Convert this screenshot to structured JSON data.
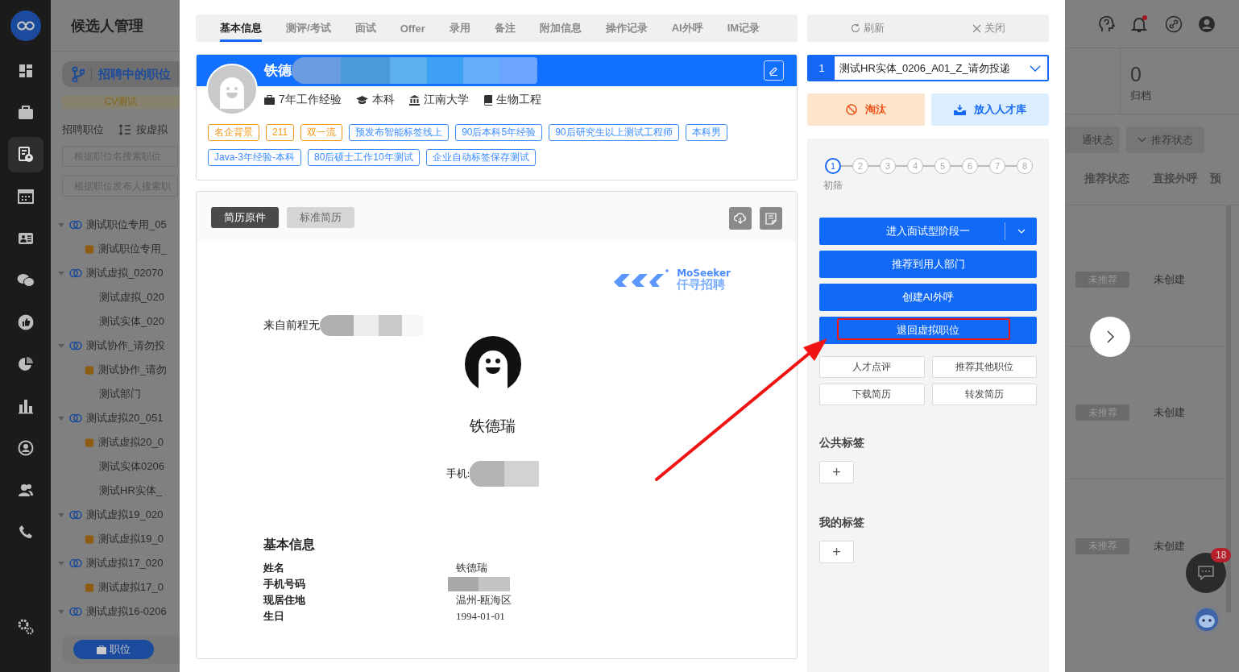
{
  "sidebar": {
    "items": [
      {
        "selected": false
      },
      {
        "selected": false
      },
      {
        "selected": true
      },
      {
        "selected": false
      },
      {
        "selected": false
      },
      {
        "selected": false
      },
      {
        "selected": false
      },
      {
        "selected": false
      },
      {
        "selected": false
      },
      {
        "selected": false
      },
      {
        "selected": false
      },
      {
        "selected": false
      }
    ]
  },
  "job_panel": {
    "title": "候选人管理",
    "switcher": "招聘中的职位",
    "notice": "CV测试",
    "section_label": "招聘职位",
    "sort_label": "按虚拟",
    "search_fields": [
      {
        "placeholder": "根据职位名搜索职位"
      },
      {
        "placeholder": "根据职位发布人搜索职"
      }
    ],
    "tree": [
      {
        "label": "测试职位专用_05",
        "expanded": true,
        "children": [
          {
            "label": "测试职位专用_",
            "kind": "stack"
          }
        ]
      },
      {
        "label": "测试虚拟_02070",
        "expanded": true,
        "children": [
          {
            "label": "测试虚拟_020",
            "kind": "plain"
          },
          {
            "label": "测试实体_020",
            "kind": "plain"
          }
        ]
      },
      {
        "label": "测试协作_请勿投",
        "expanded": true,
        "children": [
          {
            "label": "测试协作_请勿",
            "kind": "stack"
          },
          {
            "label": "测试部门",
            "kind": "plain"
          }
        ]
      },
      {
        "label": "测试虚拟20_051",
        "expanded": true,
        "children": [
          {
            "label": "测试虚拟20_0",
            "kind": "stack"
          },
          {
            "label": "测试实体0206",
            "kind": "plain"
          },
          {
            "label": "测试HR实体_",
            "kind": "plain"
          }
        ]
      },
      {
        "label": "测试虚拟19_020",
        "expanded": true,
        "children": [
          {
            "label": "测试虚拟19_0",
            "kind": "stack"
          }
        ]
      },
      {
        "label": "测试虚拟17_020",
        "expanded": true,
        "children": [
          {
            "label": "测试虚拟17_0",
            "kind": "stack"
          }
        ]
      },
      {
        "label": "测试虚拟16-0206",
        "expanded": true
      }
    ],
    "footer_button": "职位"
  },
  "drawer": {
    "tabs": [
      {
        "label": "基本信息",
        "selected": true
      },
      {
        "label": "测评/考试",
        "selected": false
      },
      {
        "label": "面试",
        "selected": false
      },
      {
        "label": "Offer",
        "selected": false
      },
      {
        "label": "录用",
        "selected": false
      },
      {
        "label": "备注",
        "selected": false
      },
      {
        "label": "附加信息",
        "selected": false
      },
      {
        "label": "操作记录",
        "selected": false
      },
      {
        "label": "AI外呼",
        "selected": false
      },
      {
        "label": "IM记录",
        "selected": false
      }
    ],
    "profile": {
      "name": "铁德",
      "redacted": true,
      "experience": "7年工作经验",
      "degree": "本科",
      "school": "江南大学",
      "major": "生物工程",
      "tags": [
        {
          "label": "名企背景",
          "color": "#f29b18"
        },
        {
          "label": "211",
          "color": "#f29b18"
        },
        {
          "label": "双一流",
          "color": "#f29b18"
        },
        {
          "label": "预发布智能标签线上",
          "color": "#3d8bff"
        },
        {
          "label": "90后本科5年经验",
          "color": "#3d8bff"
        },
        {
          "label": "90后研究生以上测试工程师",
          "color": "#3d8bff"
        },
        {
          "label": "本科男",
          "color": "#3d8bff"
        },
        {
          "label": "Java-3年经验-本科",
          "color": "#3d8bff"
        },
        {
          "label": "80后硕士工作10年测试",
          "color": "#3d8bff"
        },
        {
          "label": "企业自动标签保存测试",
          "color": "#3d8bff"
        }
      ]
    },
    "resume": {
      "views": [
        {
          "label": "简历原件",
          "selected": true
        },
        {
          "label": "标准简历",
          "selected": false
        }
      ],
      "logo_text": "MoSeeker",
      "logo_subtitle": "仟寻招聘",
      "source": {
        "text": "来自前程无",
        "redacted": true
      },
      "name": "铁德瑞",
      "phone": {
        "label": "手机:",
        "redacted": true
      },
      "section_title": "基本信息",
      "rows": [
        {
          "label": "姓名",
          "value": "铁德瑞"
        },
        {
          "label": "手机号码",
          "redacted": true
        },
        {
          "label": "现居住地",
          "value": "温州-瓯海区"
        },
        {
          "label": "生日",
          "value": "1994-01-01"
        }
      ]
    }
  },
  "actions": {
    "refresh": "刷新",
    "close": "关闭",
    "position_select": {
      "index": "1",
      "value": "测试HR实体_0206_A01_Z_请勿投递"
    },
    "reject": "淘汰",
    "talent_pool": "放入人才库",
    "steps": [
      {
        "label": "1",
        "selected": true,
        "caption": "初筛"
      },
      {
        "label": "2",
        "selected": false
      },
      {
        "label": "3",
        "selected": false
      },
      {
        "label": "4",
        "selected": false
      },
      {
        "label": "5",
        "selected": false
      },
      {
        "label": "6",
        "selected": false
      },
      {
        "label": "7",
        "selected": false
      },
      {
        "label": "8",
        "selected": false
      }
    ],
    "primary_buttons": [
      {
        "label": "进入面试型阶段一",
        "kind": "split",
        "expanded": false,
        "highlighted": false
      },
      {
        "label": "推荐到用人部门",
        "kind": "plain",
        "highlighted": false
      },
      {
        "label": "创建AI外呼",
        "kind": "plain",
        "highlighted": false
      },
      {
        "label": "退回虚拟职位",
        "kind": "plain",
        "highlighted": true
      }
    ],
    "secondary_buttons": [
      "人才点评",
      "推荐其他职位",
      "下载简历",
      "转发简历"
    ],
    "tag_groups": [
      {
        "title": "公共标签",
        "add": "+"
      },
      {
        "title": "我的标签",
        "add": "+"
      }
    ]
  },
  "list_view": {
    "archive_count": "0",
    "archive_label": "归档",
    "filters": [
      {
        "label": "通状态",
        "caret": false
      },
      {
        "label": "推荐状态",
        "caret": true
      }
    ],
    "columns": [
      "推荐状态",
      "直接外呼",
      "预"
    ],
    "rows": [
      {
        "status": "未推荐",
        "call": "未创建"
      },
      {
        "status": "未推荐",
        "call": "未创建"
      },
      {
        "status": "未推荐",
        "call": "未创建"
      }
    ],
    "chat_badge": "18"
  }
}
